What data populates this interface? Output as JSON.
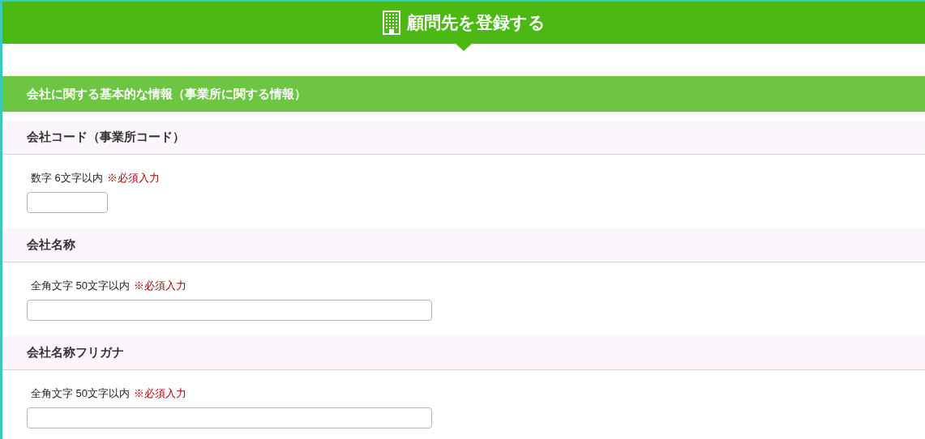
{
  "header": {
    "title": "顧問先を登録する"
  },
  "section": {
    "title": "会社に関する基本的な情報（事業所に関する情報）"
  },
  "fields": [
    {
      "label": "会社コード（事業所コード）",
      "hint": "数字 6文字以内",
      "required": "※必須入力",
      "kind": "short"
    },
    {
      "label": "会社名称",
      "hint": "全角文字 50文字以内",
      "required": "※必須入力",
      "kind": "long"
    },
    {
      "label": "会社名称フリガナ",
      "hint": "全角文字 50文字以内",
      "required": "※必須入力",
      "kind": "long"
    }
  ]
}
